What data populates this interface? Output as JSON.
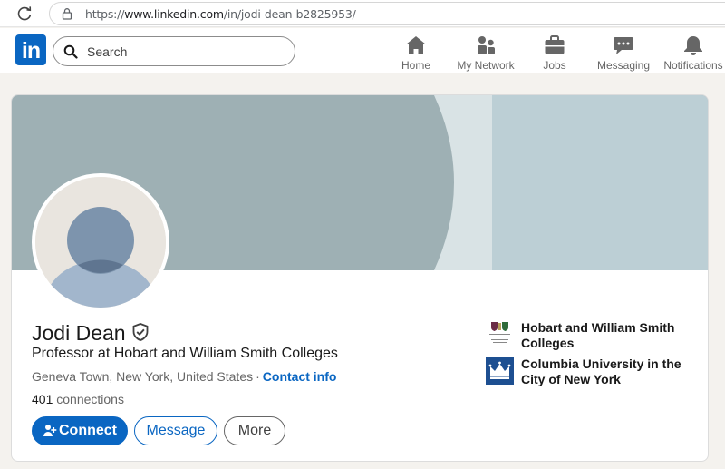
{
  "browser": {
    "url_prefix": "https://",
    "url_domain": "www.linkedin.com",
    "url_path": "/in/jodi-dean-b2825953/"
  },
  "nav": {
    "logo": "in",
    "search_placeholder": "Search",
    "items": [
      {
        "label": "Home",
        "icon": "home-icon"
      },
      {
        "label": "My Network",
        "icon": "network-icon"
      },
      {
        "label": "Jobs",
        "icon": "briefcase-icon"
      },
      {
        "label": "Messaging",
        "icon": "chat-icon"
      },
      {
        "label": "Notifications",
        "icon": "bell-icon"
      }
    ],
    "accent": "#0a66c2"
  },
  "profile": {
    "name": "Jodi Dean",
    "headline": "Professor at Hobart and William Smith Colleges",
    "location": "Geneva Town, New York, United States",
    "contact_label": "Contact info",
    "connections_count": "401",
    "connections_label": "connections",
    "actions": {
      "connect": "Connect",
      "message": "Message",
      "more": "More"
    },
    "organizations": [
      {
        "name": "Hobart and William Smith Colleges",
        "icon": "hws-crest-logo"
      },
      {
        "name": "Columbia University in the City of New York",
        "icon": "columbia-crown-logo"
      }
    ]
  }
}
